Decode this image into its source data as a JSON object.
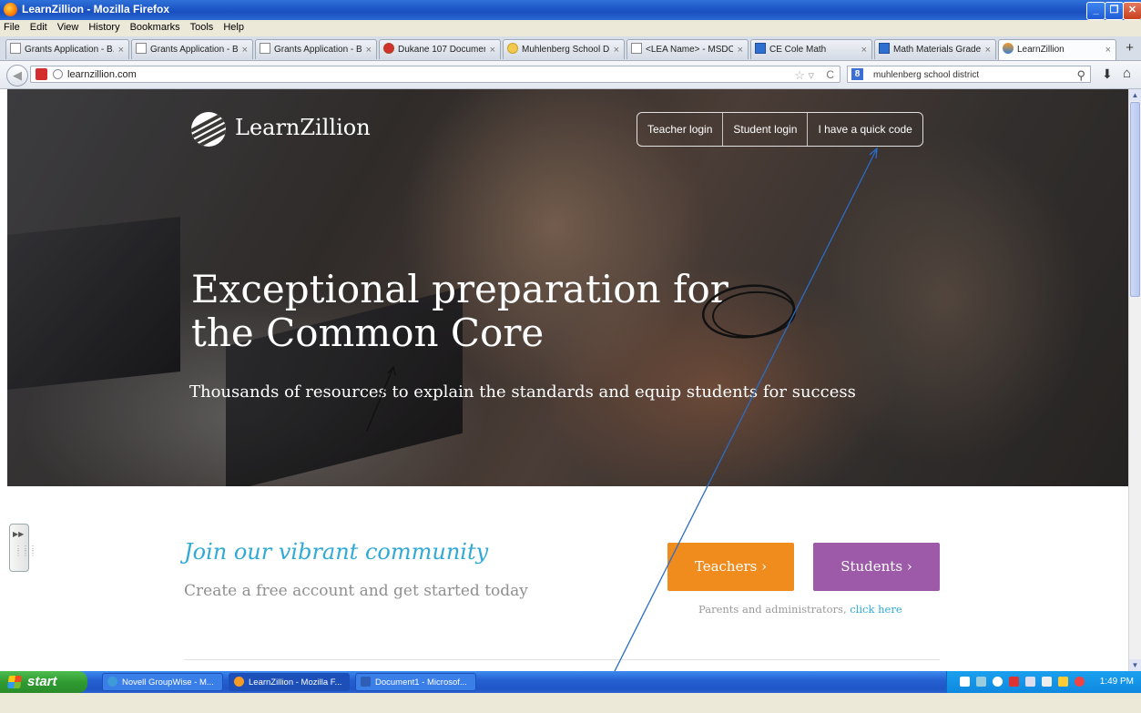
{
  "window": {
    "title": "LearnZillion - Mozilla Firefox"
  },
  "menu": [
    "File",
    "Edit",
    "View",
    "History",
    "Bookmarks",
    "Tools",
    "Help"
  ],
  "tabs": [
    {
      "label": "Grants Application - B...",
      "icon": "page-icon"
    },
    {
      "label": "Grants Application - B...",
      "icon": "page-icon"
    },
    {
      "label": "Grants Application - B...",
      "icon": "page-icon"
    },
    {
      "label": "Dukane 107 Documen...",
      "icon": "red-icon"
    },
    {
      "label": "Muhlenberg School Di...",
      "icon": "yellow-icon"
    },
    {
      "label": "<LEA Name> - MSDC...",
      "icon": "page-icon"
    },
    {
      "label": "CE Cole Math",
      "icon": "blue-icon"
    },
    {
      "label": "Math Materials Grade...",
      "icon": "blue-icon"
    },
    {
      "label": "LearnZillion",
      "icon": "learnzillion-icon",
      "active": true
    }
  ],
  "navbar": {
    "url": "learnzillion.com",
    "search_query": "muhlenberg school district",
    "search_engine": "8"
  },
  "page": {
    "brand": "LearnZillion",
    "login": {
      "teacher": "Teacher login",
      "student": "Student login",
      "quick_code": "I have a quick code"
    },
    "hero": {
      "headline_1": "Exceptional preparation for",
      "headline_2": "the Common Core",
      "subheadline": "Thousands of resources to explain the standards and equip students for success"
    },
    "join": {
      "title": "Join our vibrant community",
      "subtitle": "Create a free account and get started today",
      "teachers_button": "Teachers ›",
      "students_button": "Students ›",
      "parents_text": "Parents and administrators, ",
      "parents_link": "click here"
    }
  },
  "taskbar": {
    "start": "start",
    "items": [
      {
        "label": "Novell GroupWise - M..."
      },
      {
        "label": "LearnZillion - Mozilla F..."
      },
      {
        "label": "Document1 - Microsof..."
      }
    ],
    "clock": "1:49 PM"
  },
  "colors": {
    "accent_blue": "#2fa9d6",
    "teachers_orange": "#f08c1e",
    "students_purple": "#9c5aa8"
  }
}
